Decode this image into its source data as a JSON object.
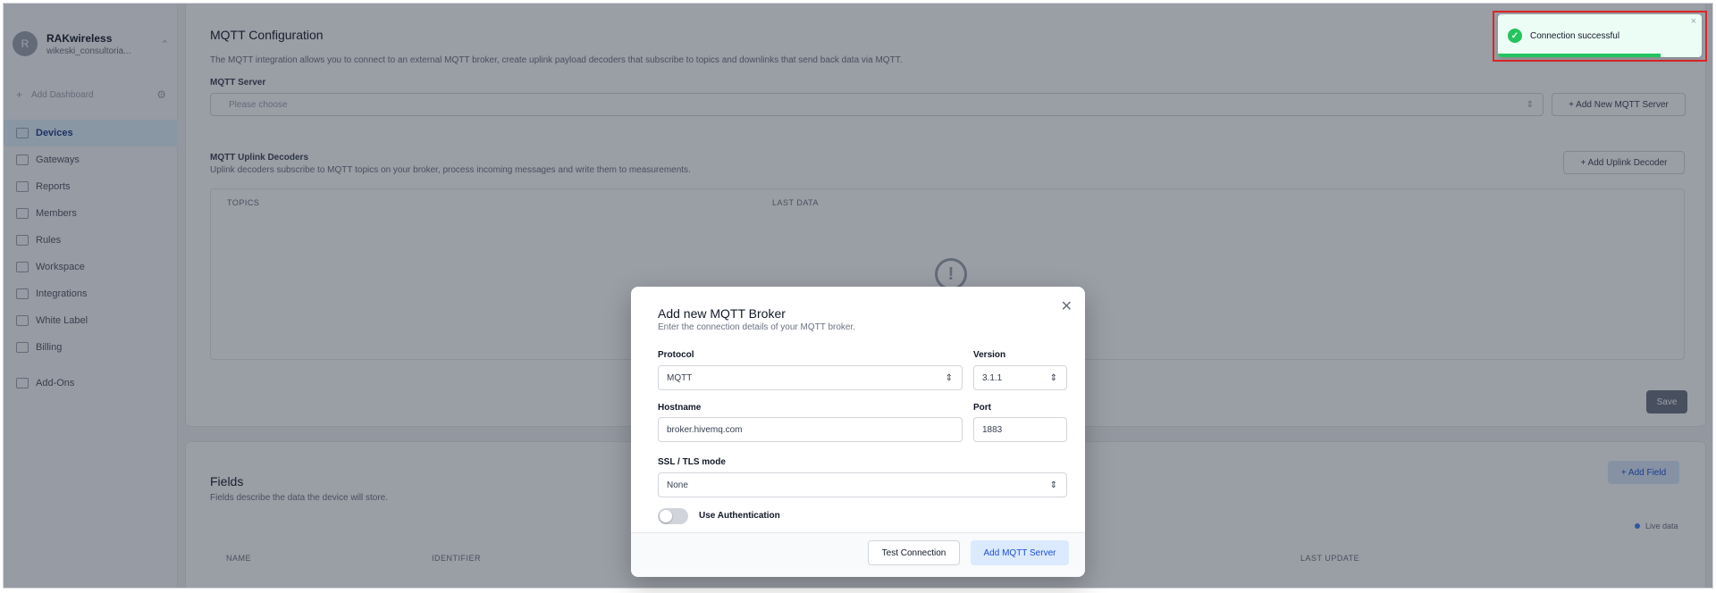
{
  "sidebar": {
    "org_initial": "R",
    "org_name": "RAKwireless",
    "org_sub": "wikeski_consultoria...",
    "add_dashboard": "Add Dashboard",
    "items": [
      {
        "label": "Devices",
        "active": true
      },
      {
        "label": "Gateways"
      },
      {
        "label": "Reports"
      },
      {
        "label": "Members"
      },
      {
        "label": "Rules"
      },
      {
        "label": "Workspace"
      },
      {
        "label": "Integrations"
      },
      {
        "label": "White Label"
      },
      {
        "label": "Billing"
      }
    ],
    "addons": "Add-Ons"
  },
  "mqtt_config": {
    "title": "MQTT Configuration",
    "description": "The MQTT integration allows you to connect to an external MQTT broker, create uplink payload decoders that subscribe to topics and downlinks that send back data via MQTT.",
    "server_label": "MQTT Server",
    "server_placeholder": "Please choose",
    "add_server_btn": "+ Add New MQTT Server",
    "decoders_title": "MQTT Uplink Decoders",
    "decoders_desc": "Uplink decoders subscribe to MQTT topics on your broker, process incoming messages and write them to measurements.",
    "add_decoder_btn": "+ Add Uplink Decoder",
    "col_topics": "TOPICS",
    "col_last_data": "LAST DATA",
    "save_btn": "Save"
  },
  "fields": {
    "title": "Fields",
    "desc": "Fields describe the data the device will store.",
    "add_btn": "+ Add Field",
    "live": "Live data",
    "col_name": "NAME",
    "col_identifier": "IDENTIFIER",
    "col_last_update": "LAST UPDATE"
  },
  "modal": {
    "title": "Add new MQTT Broker",
    "subtitle": "Enter the connection details of your MQTT broker.",
    "protocol_label": "Protocol",
    "protocol_value": "MQTT",
    "version_label": "Version",
    "version_value": "3.1.1",
    "hostname_label": "Hostname",
    "hostname_value": "broker.hivemq.com",
    "port_label": "Port",
    "port_value": "1883",
    "ssl_label": "SSL / TLS mode",
    "ssl_value": "None",
    "auth_label": "Use Authentication",
    "auth_enabled": false,
    "test_btn": "Test Connection",
    "add_btn": "Add MQTT Server"
  },
  "toast": {
    "message": "Connection successful",
    "progress": 0.8,
    "color": "#22c55e"
  }
}
